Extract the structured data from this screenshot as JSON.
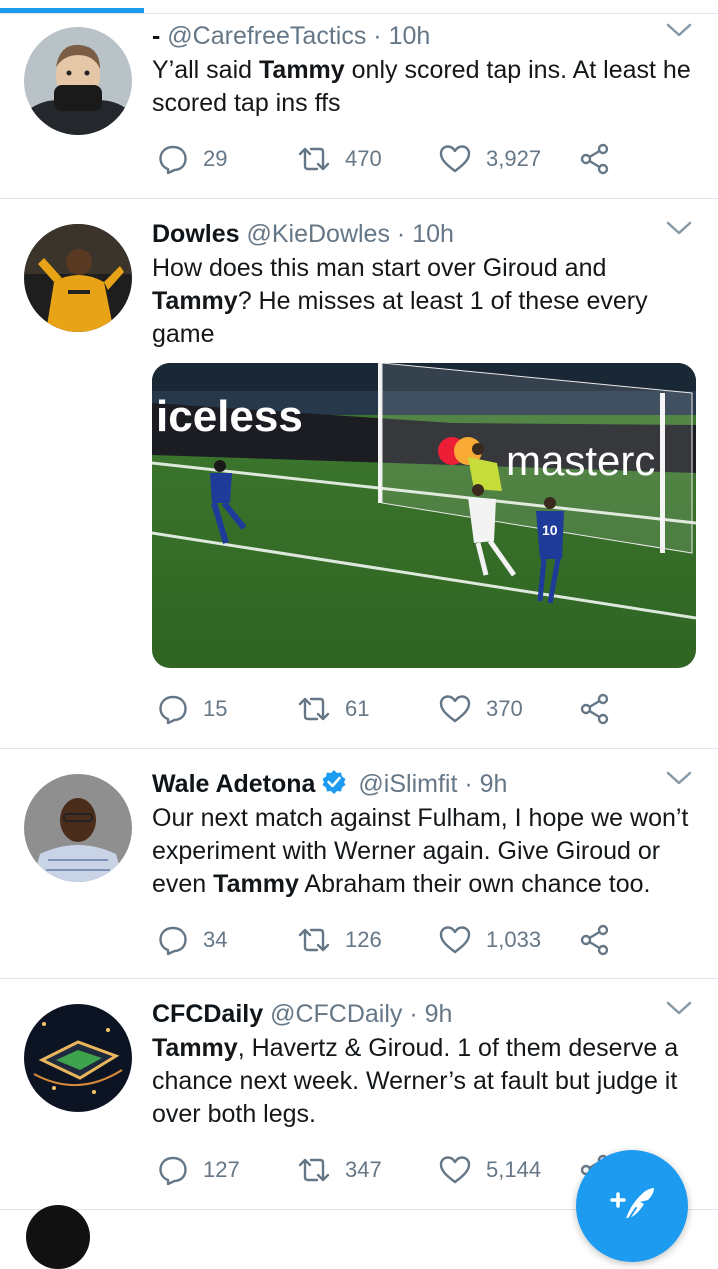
{
  "tweets": [
    {
      "name": "-",
      "handle": "@CarefreeTactics",
      "time": "10h",
      "text_parts": [
        "Y’all said ",
        "Tammy",
        " only scored tap ins. At least he scored tap ins ffs"
      ],
      "replies": "29",
      "retweets": "470",
      "likes": "3,927"
    },
    {
      "name": "Dowles",
      "handle": "@KieDowles",
      "time": "10h",
      "text_parts": [
        "How does this man start over Giroud and ",
        "Tammy",
        "? He misses at least 1 of these every game"
      ],
      "media_overlay_text": [
        "iceless",
        "masterc"
      ],
      "media_shirt_number": "10",
      "replies": "15",
      "retweets": "61",
      "likes": "370"
    },
    {
      "name": "Wale Adetona",
      "verified": true,
      "handle": "@iSlimfit",
      "time": "9h",
      "text_parts": [
        "Our next match against Fulham, I hope we won’t experiment with Werner again. Give Giroud or even ",
        "Tammy",
        " Abraham their own chance too."
      ],
      "replies": "34",
      "retweets": "126",
      "likes": "1,033"
    },
    {
      "name": "CFCDaily",
      "handle": "@CFCDaily",
      "time": "9h",
      "text_parts": [
        "Tammy",
        ", Havertz & Giroud. 1 of them deserve a chance next week. Werner’s at fault but judge it over both legs."
      ],
      "replies": "127",
      "retweets": "347",
      "likes": "5,144"
    }
  ],
  "separator": " · ",
  "fab": {
    "icon": "compose-tweet-icon",
    "label": "+"
  },
  "colors": {
    "accent": "#1d9bf0",
    "secondary_text": "#657786",
    "border": "#e1e8ed"
  }
}
